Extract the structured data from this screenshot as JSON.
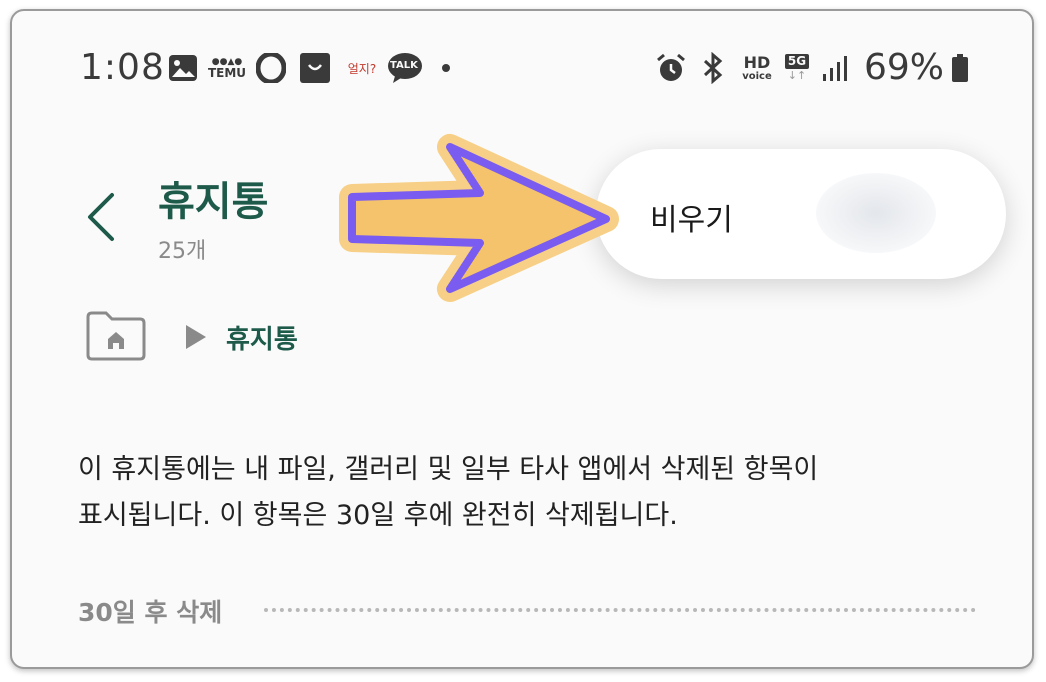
{
  "status_bar": {
    "time": "1:08",
    "notification_icons": [
      "gallery-icon",
      "temu-icon",
      "opera-icon",
      "shopping-bag-icon",
      "oeji-icon",
      "talk-icon",
      "more-dot-icon"
    ],
    "temu_text": "TEMU",
    "oeji_text": "얼지?",
    "talk_text": "TALK",
    "hd_text": "HD",
    "voice_text": "voice",
    "network_text": "5G",
    "battery_percent": "69%",
    "system_icons": [
      "alarm-icon",
      "bluetooth-icon",
      "hd-voice-icon",
      "5g-icon",
      "signal-icon",
      "battery-icon"
    ]
  },
  "header": {
    "title": "휴지통",
    "item_count": "25개"
  },
  "popup_menu": {
    "items": [
      {
        "label": "비우기"
      }
    ]
  },
  "breadcrumb": {
    "current": "휴지통"
  },
  "description": {
    "line1": "이 휴지통에는 내 파일, 갤러리 및 일부 타사 앱에서 삭제된 항목이",
    "line2": "표시됩니다. 이 항목은 30일 후에 완전히 삭제됩니다."
  },
  "section": {
    "label": "30일 후 삭제"
  },
  "colors": {
    "accent": "#1e5a4a",
    "arrow_fill": "#f5c36b",
    "arrow_stroke": "#7b5cf0",
    "text_gray": "#8a8a8a"
  }
}
